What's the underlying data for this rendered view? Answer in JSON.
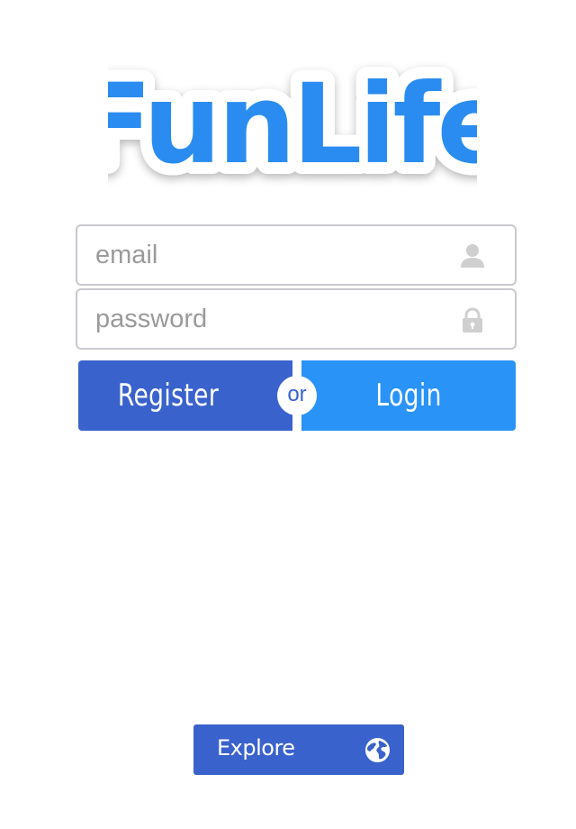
{
  "logo": {
    "text": "FunLife",
    "fill_color": "#2a8cf0",
    "outline_color": "#ffffff"
  },
  "form": {
    "email": {
      "value": "",
      "placeholder": "email",
      "icon": "user-icon"
    },
    "password": {
      "value": "",
      "placeholder": "password",
      "icon": "lock-icon"
    }
  },
  "actions": {
    "register_label": "Register",
    "or_label": "or",
    "login_label": "Login"
  },
  "explore": {
    "label": "Explore",
    "icon": "globe-icon"
  },
  "colors": {
    "register_bg": "#3a62cc",
    "login_bg": "#2a93f7",
    "explore_bg": "#3a62cc",
    "field_border": "#c9c9cf",
    "icon_gray": "#cfcfcf"
  }
}
